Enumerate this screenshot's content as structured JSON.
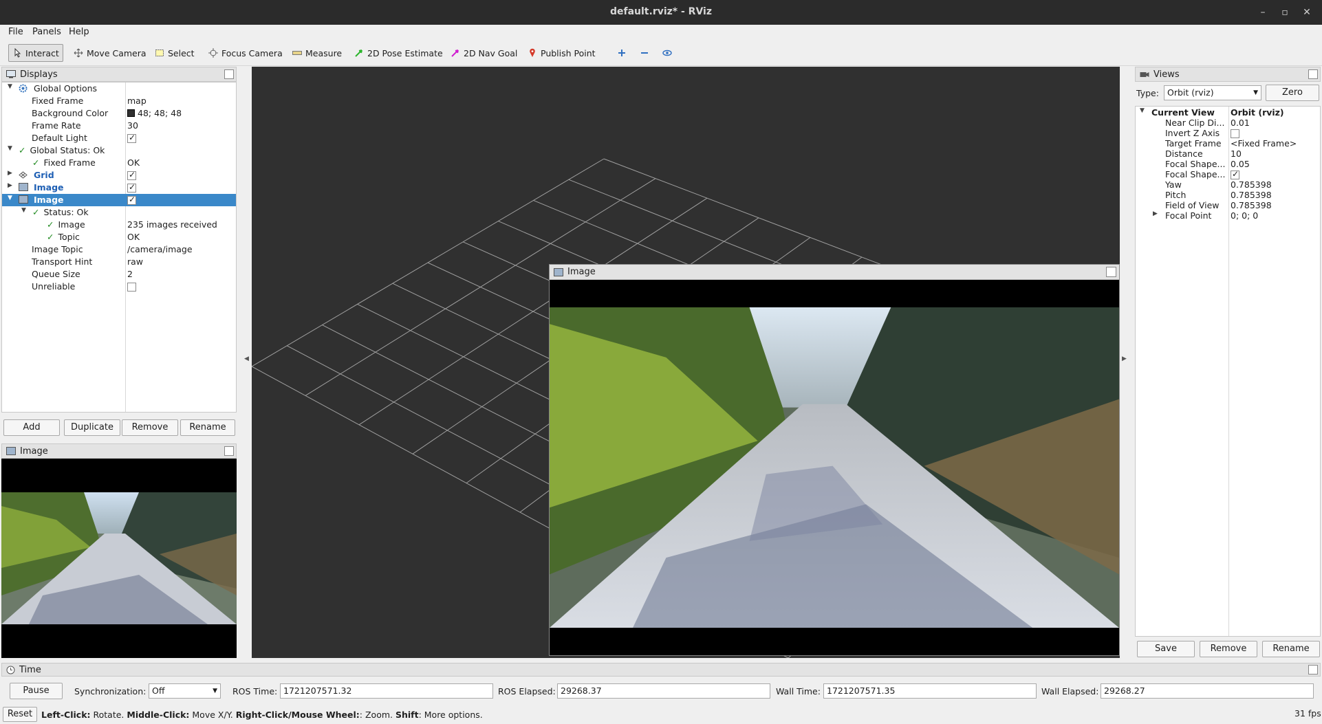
{
  "window": {
    "title": "default.rviz* - RViz"
  },
  "menu": [
    "File",
    "Panels",
    "Help"
  ],
  "toolbar": {
    "interact": "Interact",
    "move_camera": "Move Camera",
    "select": "Select",
    "focus_camera": "Focus Camera",
    "measure": "Measure",
    "pose_estimate": "2D Pose Estimate",
    "nav_goal": "2D Nav Goal",
    "publish_point": "Publish Point"
  },
  "displays": {
    "title": "Displays",
    "global_options": "Global Options",
    "fixed_frame_label": "Fixed Frame",
    "fixed_frame_value": "map",
    "bg_color_label": "Background Color",
    "bg_color_value": "48; 48; 48",
    "frame_rate_label": "Frame Rate",
    "frame_rate_value": "30",
    "default_light_label": "Default Light",
    "global_status": "Global Status: Ok",
    "gs_fixed_frame_label": "Fixed Frame",
    "gs_fixed_frame_value": "OK",
    "grid": "Grid",
    "image1": "Image",
    "image2": "Image",
    "status_ok": "Status: Ok",
    "status_image_label": "Image",
    "status_image_value": "235 images received",
    "status_topic_label": "Topic",
    "status_topic_value": "OK",
    "image_topic_label": "Image Topic",
    "image_topic_value": "/camera/image",
    "transport_hint_label": "Transport Hint",
    "transport_hint_value": "raw",
    "queue_size_label": "Queue Size",
    "queue_size_value": "2",
    "unreliable_label": "Unreliable",
    "buttons": {
      "add": "Add",
      "duplicate": "Duplicate",
      "remove": "Remove",
      "rename": "Rename"
    }
  },
  "image_panel": {
    "title": "Image"
  },
  "image_window": {
    "title": "Image"
  },
  "views": {
    "title": "Views",
    "type_label": "Type:",
    "type_value": "Orbit (rviz)",
    "zero": "Zero",
    "current_view": "Current View",
    "current_view_value": "Orbit (rviz)",
    "rows": [
      {
        "k": "Near Clip Di...",
        "v": "0.01"
      },
      {
        "k": "Invert Z Axis",
        "v": ""
      },
      {
        "k": "Target Frame",
        "v": "<Fixed Frame>"
      },
      {
        "k": "Distance",
        "v": "10"
      },
      {
        "k": "Focal Shape...",
        "v": "0.05"
      },
      {
        "k": "Focal Shape...",
        "v": ""
      },
      {
        "k": "Yaw",
        "v": "0.785398"
      },
      {
        "k": "Pitch",
        "v": "0.785398"
      },
      {
        "k": "Field of View",
        "v": "0.785398"
      },
      {
        "k": "Focal Point",
        "v": "0; 0; 0"
      }
    ],
    "buttons": {
      "save": "Save",
      "remove": "Remove",
      "rename": "Rename"
    }
  },
  "time": {
    "title": "Time",
    "pause": "Pause",
    "sync_label": "Synchronization:",
    "sync_value": "Off",
    "ros_time_label": "ROS Time:",
    "ros_time": "1721207571.32",
    "ros_elapsed_label": "ROS Elapsed:",
    "ros_elapsed": "29268.37",
    "wall_time_label": "Wall Time:",
    "wall_time": "1721207571.35",
    "wall_elapsed_label": "Wall Elapsed:",
    "wall_elapsed": "29268.27"
  },
  "status_bar": {
    "reset": "Reset",
    "hint_b1": "Left-Click:",
    "hint_t1": " Rotate. ",
    "hint_b2": "Middle-Click:",
    "hint_t2": " Move X/Y. ",
    "hint_b3": "Right-Click/Mouse Wheel:",
    "hint_t3": ": Zoom. ",
    "hint_b4": "Shift",
    "hint_t4": ": More options.",
    "fps": "31 fps"
  },
  "colors": {
    "viewport_bg": "#303030",
    "selection": "#3a88c9",
    "grid_line": "#a0a0a0"
  }
}
